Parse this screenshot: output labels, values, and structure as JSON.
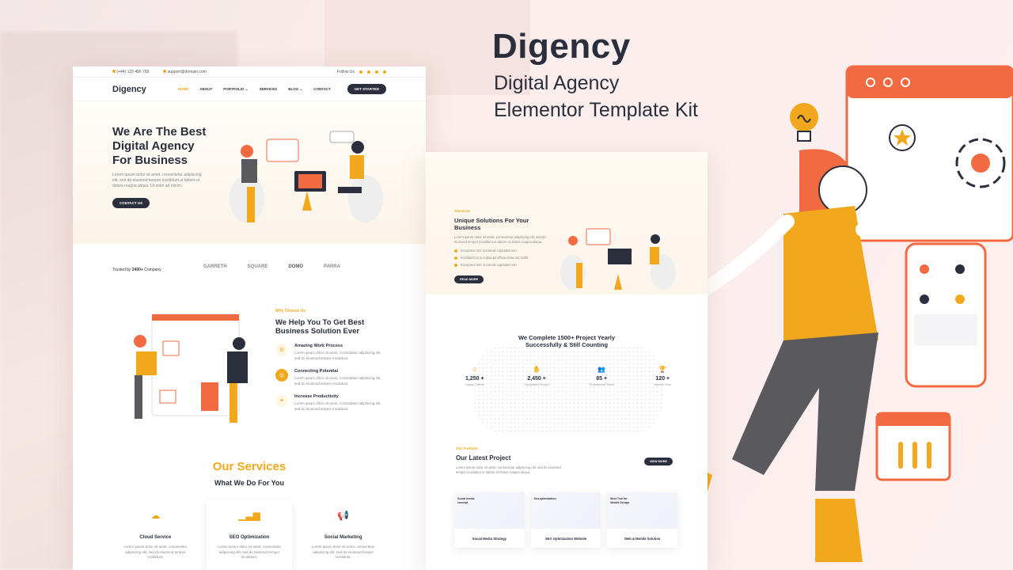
{
  "promo": {
    "title": "Digency",
    "subtitle_line1": "Digital Agency",
    "subtitle_line2": "Elementor Template Kit"
  },
  "colors": {
    "accent": "#f2a81d",
    "dark": "#2b2f3d",
    "orange": "#f26a42"
  },
  "page_a": {
    "topbar": {
      "phone": "(+44) 123 456 789",
      "email": "support@domain.com",
      "follow": "Follow Us"
    },
    "logo": "Digency",
    "nav": [
      "HOME",
      "ABOUT",
      "PORTFOLIO ⌄",
      "SERVICES",
      "BLOG ⌄",
      "CONTACT"
    ],
    "cta": "GET STARTED",
    "hero": {
      "title_l1": "We Are The Best",
      "title_l2": "Digital Agency",
      "title_l3": "For Business",
      "text": "Lorem ipsum dolor sit amet, consectetur adipiscing elit, sed do eiusmod tempor incididunt ut labore et dolore magna aliqua. Ut enim ad minim.",
      "button": "CONTACT US"
    },
    "trusted": {
      "prefix": "Trusted by",
      "count": "2400+",
      "suffix": "Company"
    },
    "brands": [
      "GARRETH",
      "SQUARE",
      "DOMO",
      "PARRA"
    ],
    "why": {
      "kicker": "Why Choose Us",
      "title": "We Help You To Get Best Business Solution Ever",
      "features": [
        {
          "title": "Amazing Work Process",
          "text": "Lorem ipsum dolor sit amet, consectetur adipiscing elit, sed do eiusmod tempor incididunt."
        },
        {
          "title": "Connecting Potential",
          "text": "Lorem ipsum dolor sit amet, consectetur adipiscing elit, sed do eiusmod tempor incididunt."
        },
        {
          "title": "Increase Productivity",
          "text": "Lorem ipsum dolor sit amet, consectetur adipiscing elit, sed do eiusmod tempor incididunt."
        }
      ]
    },
    "services": {
      "title": "Our Services",
      "subtitle": "What We Do For You",
      "items": [
        {
          "name": "Cloud Service",
          "text": "Lorem ipsum dolor sit amet, consectetur adipiscing elit, sed do eiusmod tempor incididunt."
        },
        {
          "name": "SEO Optimization",
          "text": "Lorem ipsum dolor sit amet, consectetur adipiscing elit, sed do eiusmod tempor incididunt."
        },
        {
          "name": "Social Marketing",
          "text": "Lorem ipsum dolor sit amet, consectetur adipiscing elit, sed do eiusmod tempor incididunt."
        }
      ]
    }
  },
  "page_b": {
    "about": {
      "kicker": "About Us",
      "title": "Unique Solutions For Your Business",
      "text": "Lorem ipsum dolor sit amet, consectetur adipiscing elit, sed do eiusmod tempor incididunt ut labore et dolore magna aliqua.",
      "bullets": [
        "Excepteur sint occaecat cupidatat non",
        "Incididunt ut in culpa qui officia deserunt mollit",
        "Excepteur sint occaecat cupidatat non"
      ],
      "button": "READ MORE"
    },
    "complete": {
      "line1": "We Complete 1500+ Project Yearly",
      "line2": "Successfully & Still Counting"
    },
    "stats": [
      {
        "value": "1,250 +",
        "label": "Happy Clients"
      },
      {
        "value": "2,450 +",
        "label": "Completed Project"
      },
      {
        "value": "85 +",
        "label": "Professional Team"
      },
      {
        "value": "120 +",
        "label": "Awards Won"
      }
    ],
    "portfolio": {
      "kicker": "Our Portfolio",
      "title": "Our Latest Project",
      "text": "Lorem ipsum dolor sit amet, consectetur adipiscing elit, sed do eiusmod tempor incididunt ut labore et dolore magna aliqua.",
      "button": "VIEW MORE",
      "projects": [
        {
          "tag": "Social media concept",
          "name": "Social Media Strategy"
        },
        {
          "tag": "Seo optimization",
          "name": "SEO Optimization Website"
        },
        {
          "tag": "Best Tool for Mobile Design",
          "name": "Web & Mobile Solution"
        }
      ]
    }
  }
}
